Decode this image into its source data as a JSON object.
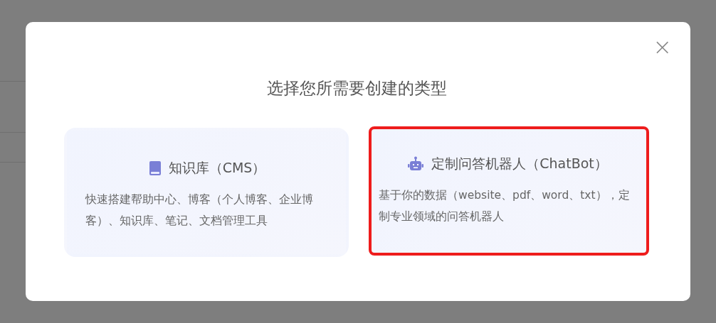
{
  "dialog": {
    "title": "选择您所需要创建的类型",
    "close": "×",
    "options": [
      {
        "kind": "book",
        "title": "知识库（CMS）",
        "description": "快速搭建帮助中心、博客（个人博客、企业博客）、知识库、笔记、文档管理工具",
        "highlighted": false
      },
      {
        "kind": "robot",
        "title": "定制问答机器人（ChatBot）",
        "description": "基于你的数据（website、pdf、word、txt），定制专业领域的问答机器人",
        "highlighted": true
      }
    ]
  }
}
